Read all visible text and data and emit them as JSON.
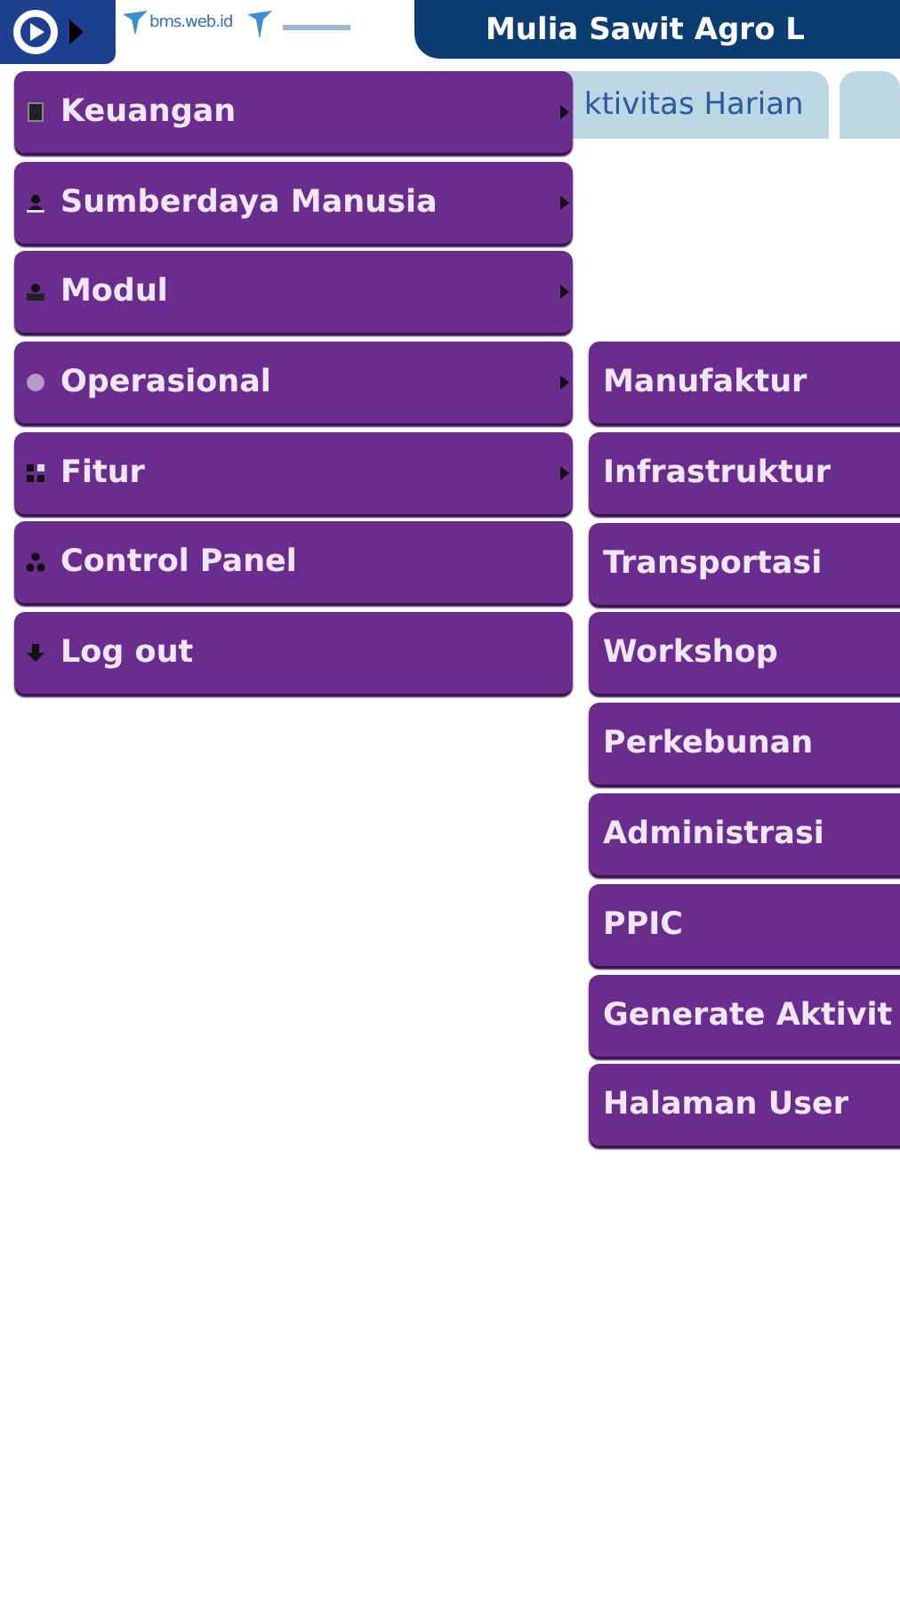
{
  "header": {
    "logo_text": "bms.web.id",
    "title": "Mulia Sawit Agro L"
  },
  "tabs": [
    {
      "label": "ktivitas Harian",
      "selected": false
    },
    {
      "selected": false
    }
  ],
  "menu": [
    {
      "label": "Keuangan",
      "has_submenu": true
    },
    {
      "label": "Sumberdaya Manusia",
      "has_submenu": true
    },
    {
      "label": "Modul",
      "has_submenu": true
    },
    {
      "label": "Operasional",
      "has_submenu": true
    },
    {
      "label": "Fitur",
      "has_submenu": true
    },
    {
      "label": "Control Panel",
      "has_submenu": false
    },
    {
      "label": "Log out",
      "has_submenu": false
    }
  ],
  "submenu": [
    {
      "label": "Manufaktur"
    },
    {
      "label": "Infrastruktur"
    },
    {
      "label": "Transportasi"
    },
    {
      "label": "Workshop"
    },
    {
      "label": "Perkebunan"
    },
    {
      "label": "Administrasi"
    },
    {
      "label": "PPIC"
    },
    {
      "label": "Generate Aktivit"
    },
    {
      "label": "Halaman User"
    }
  ]
}
